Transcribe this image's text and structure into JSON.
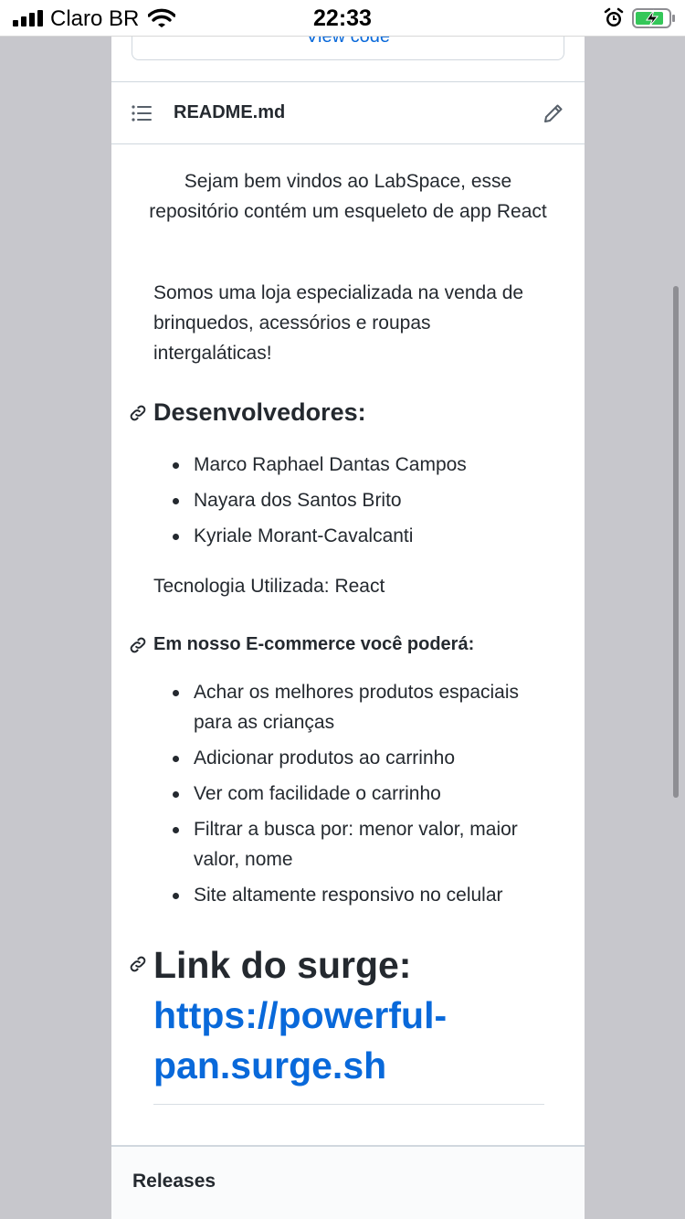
{
  "status_bar": {
    "carrier": "Claro BR",
    "time": "22:33"
  },
  "top_box": {
    "link_label": "View code"
  },
  "readme": {
    "filename": "README.md",
    "intro": "Sejam bem vindos ao LabSpace, esse repositório contém um esqueleto de app React",
    "description": "Somos uma loja especializada na venda de brinquedos, acessórios e roupas intergaláticas!",
    "developers_heading": "Desenvolvedores:",
    "developers": [
      "Marco Raphael Dantas Campos",
      "Nayara dos Santos Brito",
      "Kyriale Morant-Cavalcanti"
    ],
    "technology": "Tecnologia Utilizada: React",
    "features_heading": "Em nosso E-commerce você poderá:",
    "features": [
      "Achar os melhores produtos espaciais para as crianças",
      "Adicionar produtos ao carrinho",
      "Ver com facilidade o carrinho",
      "Filtrar a busca por: menor valor, maior valor, nome",
      "Site altamente responsivo no celular"
    ],
    "link_heading": "Link do surge:",
    "link_url": "https://powerful-pan.surge.sh"
  },
  "sidebar": {
    "releases_title": "Releases"
  },
  "colors": {
    "link": "#0969da",
    "text": "#24292f",
    "border": "#d0d7de"
  }
}
